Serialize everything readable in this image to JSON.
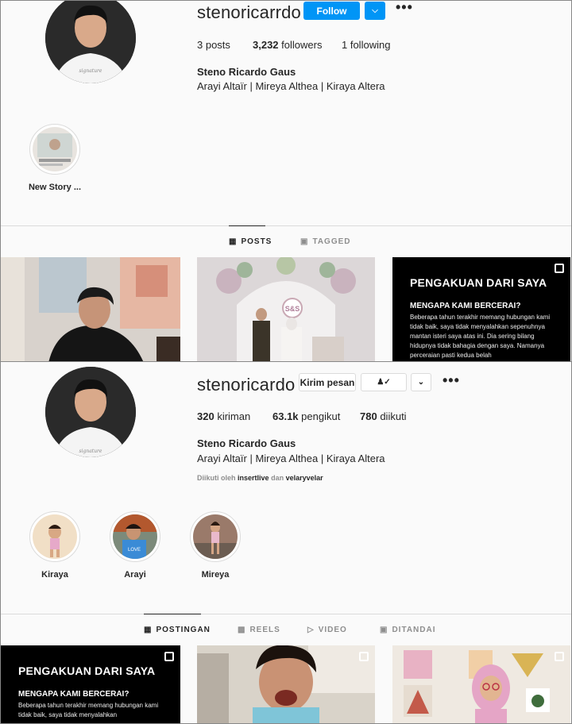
{
  "profile1": {
    "username": "stenoricarrdo",
    "follow_label": "Follow",
    "posts": "3 posts",
    "followers_count": "3,232",
    "followers_word": "followers",
    "following": "1 following",
    "full_name": "Steno Ricardo Gaus",
    "bio": "Arayi Altaïr | Mireya Althea | Kiraya Altera",
    "stories": [
      {
        "label": "New Story ..."
      }
    ],
    "tabs": [
      {
        "label": "POSTS"
      },
      {
        "label": "TAGGED"
      }
    ],
    "grid": {
      "black_title": "PENGAKUAN DARI SAYA",
      "black_sub": "MENGAPA KAMI BERCERAI?",
      "black_body": "Beberapa tahun terakhir memang hubungan kami tidak baik, saya tidak menyalahkan sepenuhnya mantan isteri saya atas ini. Dia sering bilang hidupnya tidak bahagia dengan saya. Namanya perceraian pasti kedua belah"
    }
  },
  "profile2": {
    "username": "stenoricardo",
    "message_label": "Kirim pesan",
    "posts_count": "320",
    "posts_word": "kiriman",
    "followers_count": "63.1k",
    "followers_word": "pengikut",
    "following_count": "780",
    "following_word": "diikuti",
    "full_name": "Steno Ricardo Gaus",
    "bio": "Arayi Altaïr | Mireya Althea | Kiraya Altera",
    "followed_by_prefix": "Diikuti oleh",
    "followed_by_1": "insertlive",
    "followed_by_and": "dan",
    "followed_by_2": "velaryvelar",
    "stories": [
      {
        "label": "Kiraya"
      },
      {
        "label": "Arayi"
      },
      {
        "label": "Mireya"
      }
    ],
    "tabs": [
      {
        "label": "POSTINGAN"
      },
      {
        "label": "REELS"
      },
      {
        "label": "VIDEO"
      },
      {
        "label": "DITANDAI"
      }
    ],
    "grid": {
      "black_title": "PENGAKUAN DARI SAYA",
      "black_sub": "MENGAPA KAMI BERCERAI?",
      "black_body": "Beberapa tahun terakhir memang hubungan kami tidak baik, saya tidak menyalahkan"
    }
  },
  "colors": {
    "accent": "#0095f6",
    "text": "#262626",
    "muted": "#8e8e8e"
  }
}
